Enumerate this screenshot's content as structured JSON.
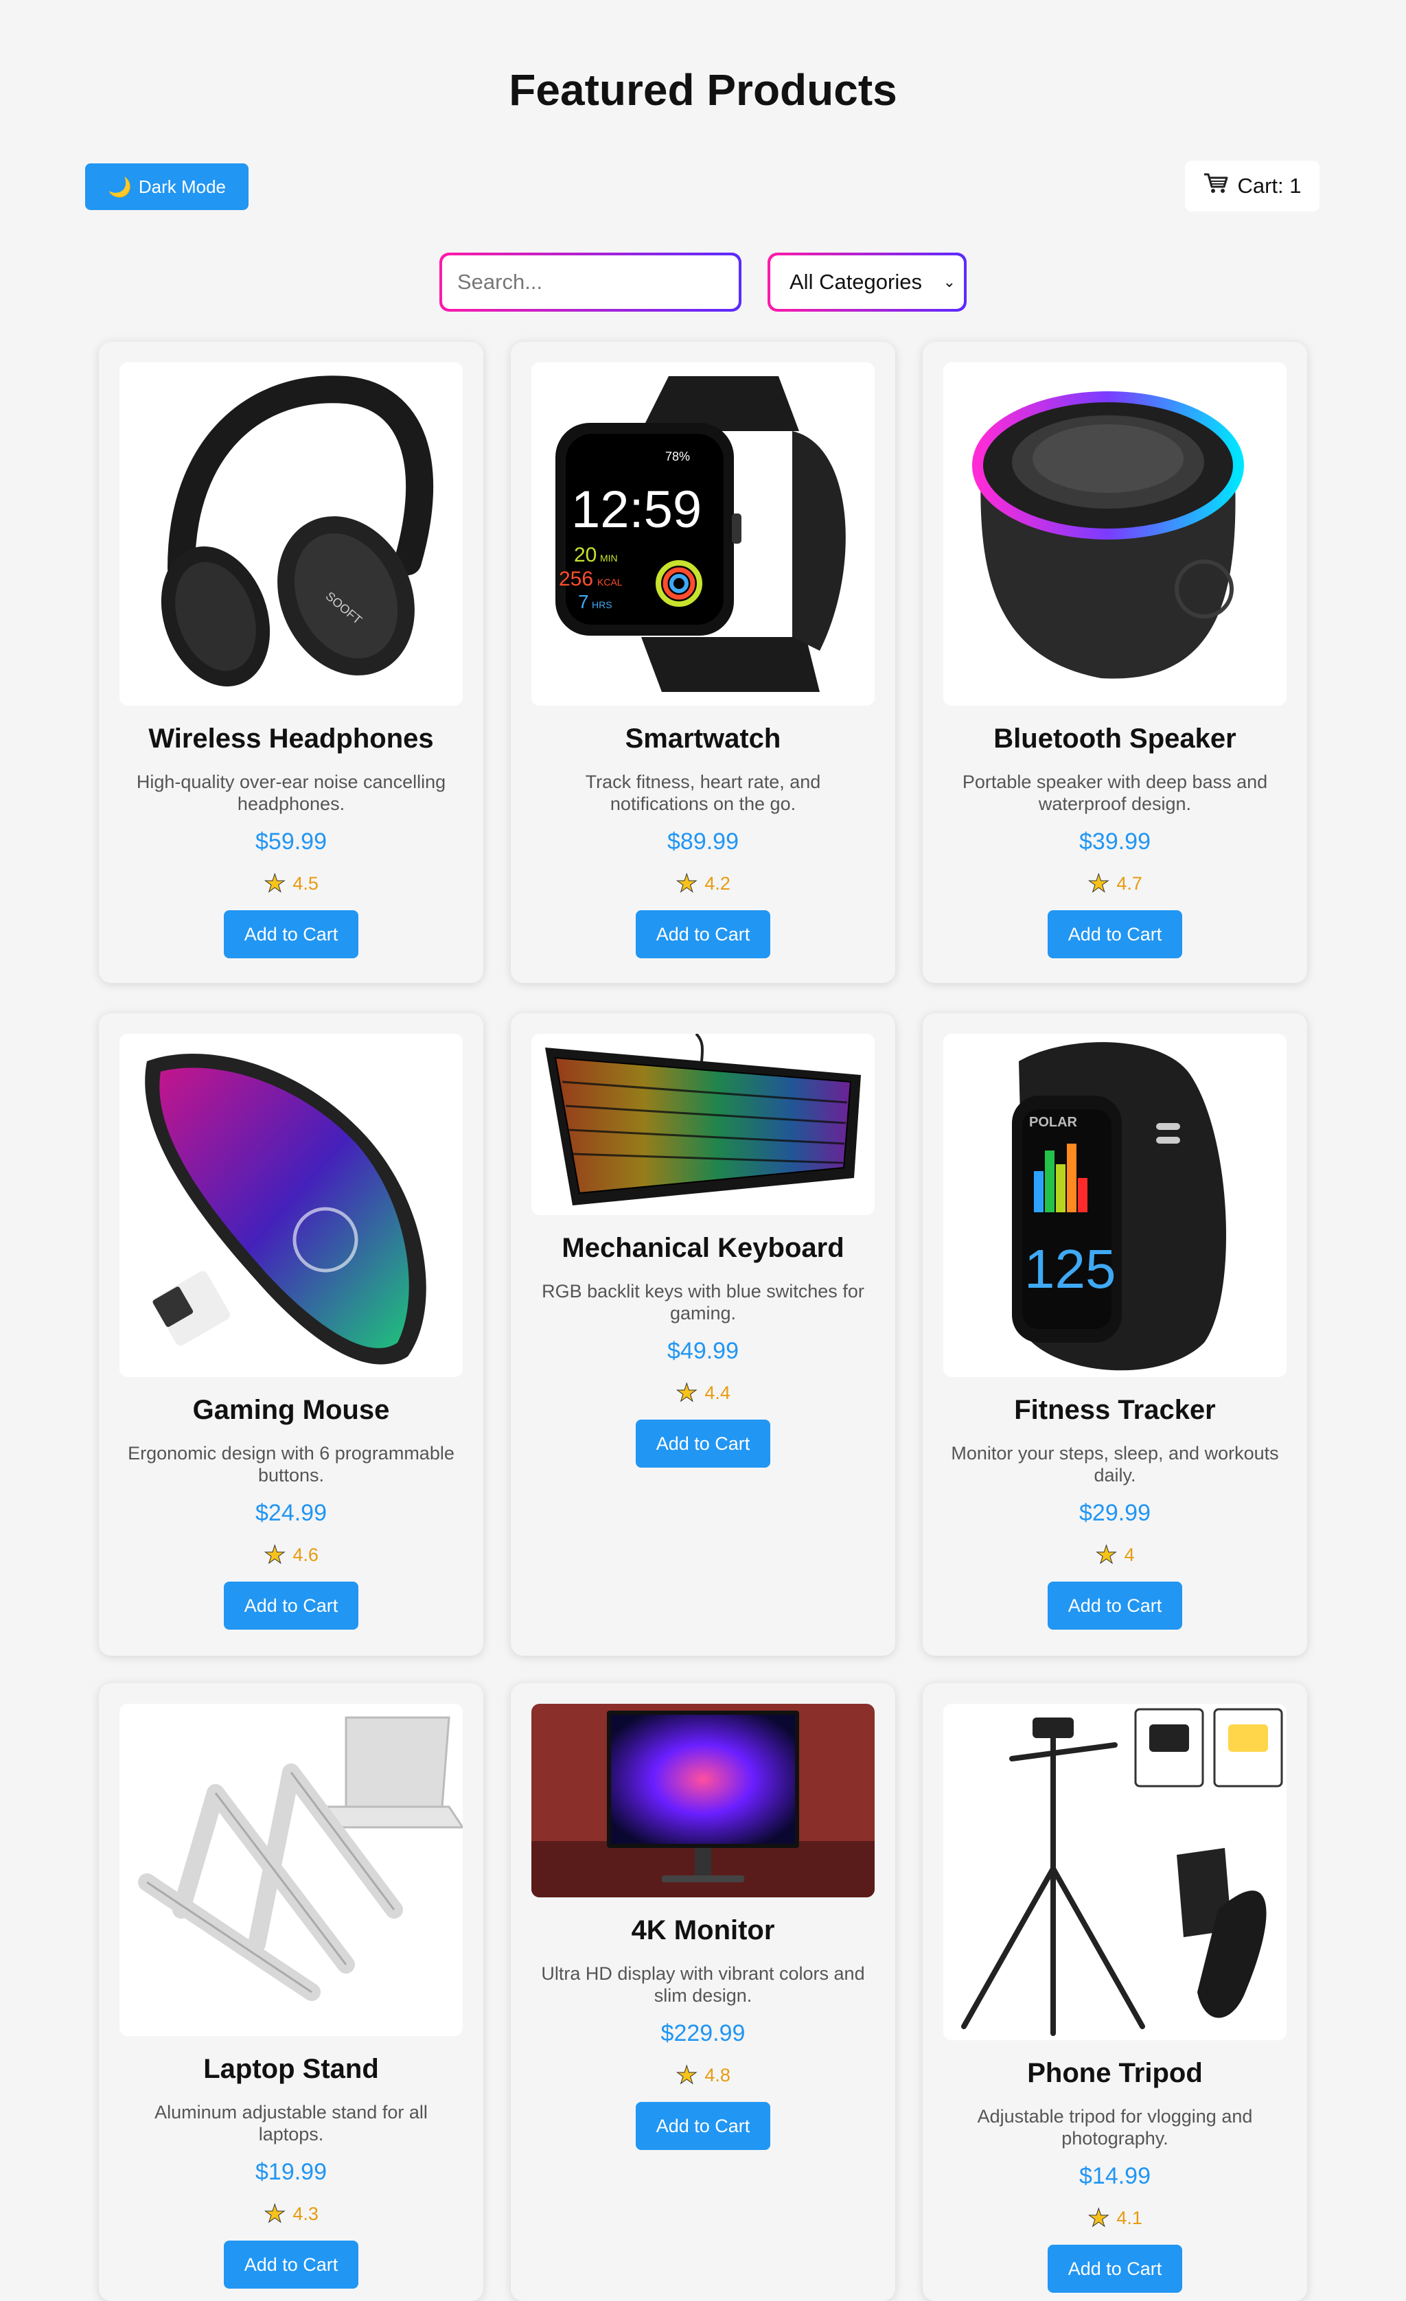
{
  "header": {
    "title": "Featured Products",
    "dark_mode_label": "Dark Mode",
    "cart_label": "Cart: 1"
  },
  "filters": {
    "search_placeholder": "Search...",
    "category_selected": "All Categories"
  },
  "products": [
    {
      "name": "Wireless Headphones",
      "description": "High-quality over-ear noise cancelling headphones.",
      "price": "$59.99",
      "rating": "4.5",
      "button": "Add to Cart",
      "image": "headphones-image"
    },
    {
      "name": "Smartwatch",
      "description": "Track fitness, heart rate, and notifications on the go.",
      "price": "$89.99",
      "rating": "4.2",
      "button": "Add to Cart",
      "image": "smartwatch-image"
    },
    {
      "name": "Bluetooth Speaker",
      "description": "Portable speaker with deep bass and waterproof design.",
      "price": "$39.99",
      "rating": "4.7",
      "button": "Add to Cart",
      "image": "speaker-image"
    },
    {
      "name": "Gaming Mouse",
      "description": "Ergonomic design with 6 programmable buttons.",
      "price": "$24.99",
      "rating": "4.6",
      "button": "Add to Cart",
      "image": "mouse-image"
    },
    {
      "name": "Mechanical Keyboard",
      "description": "RGB backlit keys with blue switches for gaming.",
      "price": "$49.99",
      "rating": "4.4",
      "button": "Add to Cart",
      "image": "keyboard-image"
    },
    {
      "name": "Fitness Tracker",
      "description": "Monitor your steps, sleep, and workouts daily.",
      "price": "$29.99",
      "rating": "4",
      "button": "Add to Cart",
      "image": "fitness-tracker-image"
    },
    {
      "name": "Laptop Stand",
      "description": "Aluminum adjustable stand for all laptops.",
      "price": "$19.99",
      "rating": "4.3",
      "button": "Add to Cart",
      "image": "laptop-stand-image"
    },
    {
      "name": "4K Monitor",
      "description": "Ultra HD display with vibrant colors and slim design.",
      "price": "$229.99",
      "rating": "4.8",
      "button": "Add to Cart",
      "image": "monitor-image"
    },
    {
      "name": "Phone Tripod",
      "description": "Adjustable tripod for vlogging and photography.",
      "price": "$14.99",
      "rating": "4.1",
      "button": "Add to Cart",
      "image": "tripod-image"
    }
  ],
  "watch_screen": {
    "time": "12:59",
    "battery": "78%",
    "min": "20",
    "kcal": "256",
    "hrs": "7",
    "min_unit": "MIN",
    "kcal_unit": "KCAL",
    "hrs_unit": "HRS"
  },
  "tracker_screen": {
    "brand": "POLAR",
    "value": "125"
  },
  "headphones_brand": "SOOFT",
  "colors": {
    "accent": "#2196f3",
    "rating": "#e89b10",
    "gradient_start": "#ff1aa8",
    "gradient_end": "#5a2bff"
  }
}
